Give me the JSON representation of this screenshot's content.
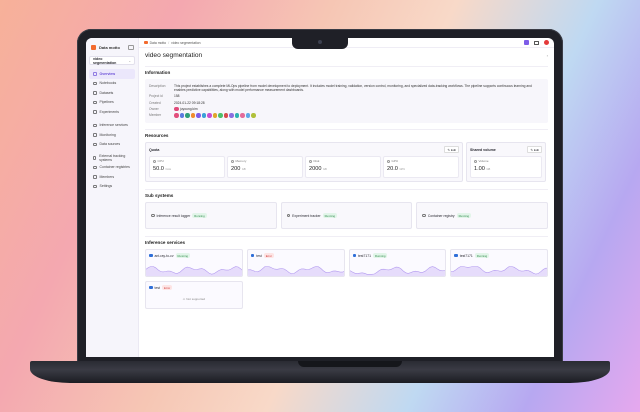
{
  "app": {
    "name": "Data motto"
  },
  "topbar": {
    "crumbs": [
      "Data motto",
      "video segmentation"
    ]
  },
  "sidebar": {
    "project": "video segmentation",
    "items": [
      {
        "label": "Overview",
        "active": true
      },
      {
        "label": "Notebooks",
        "active": false
      },
      {
        "label": "Datasets",
        "active": false
      },
      {
        "label": "Pipelines",
        "active": false
      },
      {
        "label": "Experiments",
        "active": false
      },
      {
        "label": "Inference services",
        "active": false
      },
      {
        "label": "Monitoring",
        "active": false
      },
      {
        "label": "Data sources",
        "active": false
      },
      {
        "label": "External tracking systems",
        "active": false
      },
      {
        "label": "Container registries",
        "active": false
      },
      {
        "label": "Members",
        "active": false
      },
      {
        "label": "Settings",
        "active": false
      }
    ]
  },
  "page": {
    "title": "video segmentation"
  },
  "information": {
    "title": "Information",
    "rows": [
      {
        "key": "Description",
        "value": "This project establishes a complete MLOps pipeline from model development to deployment. It includes model training, validation, version control, monitoring, and specialized data-tracking workflows. The pipeline supports continuous learning and enables predictive capabilities, along with model performance measurement dashboards."
      },
      {
        "key": "Project id",
        "value": "158"
      },
      {
        "key": "Created",
        "value": "2024-01-22 09:18:28"
      },
      {
        "key": "Owner",
        "value": "juyoung.kim"
      },
      {
        "key": "Member",
        "value": ""
      }
    ],
    "member_colors": [
      "#e24f7c",
      "#5b7be0",
      "#2e9f7a",
      "#f08c2e",
      "#7d5ce8",
      "#3aa0d8",
      "#c84fd1",
      "#e0a52b",
      "#4fbf6a",
      "#d84b4b",
      "#8a6fe0",
      "#2fb2b2",
      "#e46c9a",
      "#5fa8e8",
      "#b0c03a"
    ]
  },
  "resources": {
    "title": "Resources",
    "quota": {
      "title": "Quota",
      "edit": "Edit",
      "stats": [
        {
          "label": "CPU",
          "value": "50.0",
          "unit": "Core"
        },
        {
          "label": "Memory",
          "value": "200",
          "unit": "GB"
        },
        {
          "label": "Disk",
          "value": "2000",
          "unit": "GB"
        },
        {
          "label": "GPU",
          "value": "20.0",
          "unit": "GPU"
        }
      ]
    },
    "shared": {
      "title": "Shared volume",
      "edit": "Edit",
      "stat": {
        "label": "Volume",
        "value": "1.00",
        "unit": "GB"
      }
    }
  },
  "subsystems": {
    "title": "Sub systems",
    "items": [
      {
        "name": "Inference result logger",
        "status": "Running"
      },
      {
        "name": "Experiment tracker",
        "status": "Running"
      },
      {
        "name": "Container registry",
        "status": "Running"
      }
    ]
  },
  "inference": {
    "title": "Inference services",
    "items": [
      {
        "name": "ant-ray-to-cv",
        "status": "Running",
        "status_type": "run"
      },
      {
        "name": "test",
        "status": "Error",
        "status_type": "err"
      },
      {
        "name": "test7171",
        "status": "Running",
        "status_type": "run"
      },
      {
        "name": "test7171",
        "status": "Running",
        "status_type": "run"
      },
      {
        "name": "test",
        "status": "Error",
        "status_type": "err",
        "note": "Not supported"
      }
    ]
  }
}
